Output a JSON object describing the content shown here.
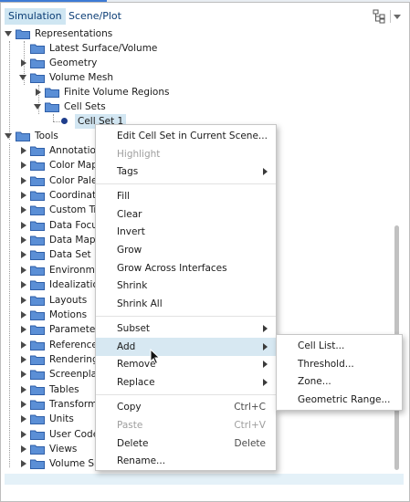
{
  "tabs": {
    "simulation": "Simulation",
    "scene_plot": "Scene/Plot"
  },
  "colors": {
    "folder": "#2f5fa8",
    "folder_light": "#5b8fd6",
    "selection": "#d2e6f2",
    "menu_highlight": "#d7e8f2",
    "disabled": "#9e9e9e"
  },
  "tree": {
    "representations": "Representations",
    "latest_surface_volume": "Latest Surface/Volume",
    "geometry": "Geometry",
    "volume_mesh": "Volume Mesh",
    "finite_volume_regions": "Finite Volume Regions",
    "cell_sets": "Cell Sets",
    "cell_set_1": "Cell Set 1",
    "tools": "Tools",
    "tools_children": [
      "Annotatio",
      "Color Map",
      "Color Pale",
      "Coordinat",
      "Custom Tr",
      "Data Focu",
      "Data Map",
      "Data Set F",
      "Environm",
      "Idealizatio",
      "Layouts",
      "Motions",
      "Paramete",
      "Reference",
      "Rendering",
      "Screenpla",
      "Tables",
      "Transform",
      "Units",
      "User Code",
      "Views",
      "Volume Sh"
    ]
  },
  "context_menu": {
    "edit_cell_set": "Edit Cell Set in Current Scene...",
    "highlight": "Highlight",
    "tags": "Tags",
    "fill": "Fill",
    "clear": "Clear",
    "invert": "Invert",
    "grow": "Grow",
    "grow_across_interfaces": "Grow Across Interfaces",
    "shrink": "Shrink",
    "shrink_all": "Shrink All",
    "subset": "Subset",
    "add": "Add",
    "remove": "Remove",
    "replace": "Replace",
    "copy": "Copy",
    "copy_shortcut": "Ctrl+C",
    "paste": "Paste",
    "paste_shortcut": "Ctrl+V",
    "delete": "Delete",
    "delete_shortcut": "Delete",
    "rename": "Rename..."
  },
  "submenu": {
    "cell_list": "Cell List...",
    "threshold": "Threshold...",
    "zone": "Zone...",
    "geometric_range": "Geometric Range..."
  }
}
